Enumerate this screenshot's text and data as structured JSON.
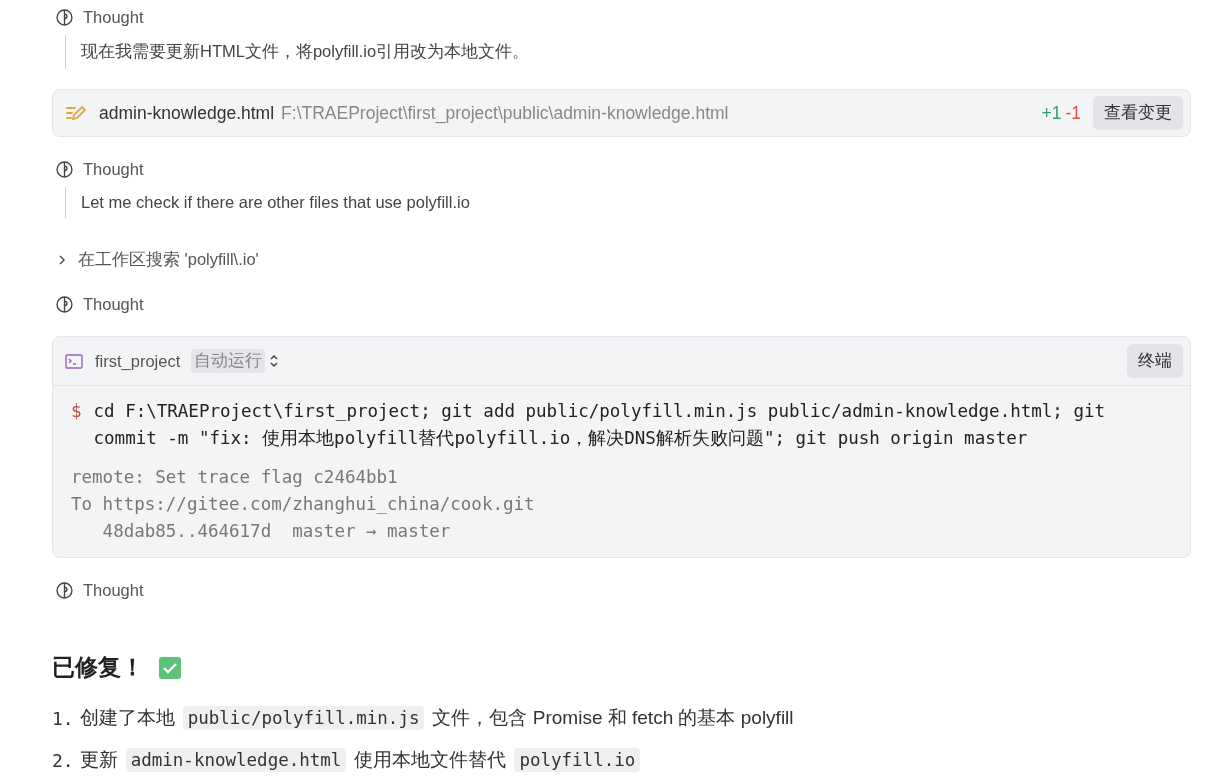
{
  "blocks": [
    {
      "kind": "thought",
      "label": "Thought",
      "text": "现在我需要更新HTML文件，将polyfill.io引用改为本地文件。"
    },
    {
      "kind": "file_edit",
      "name": "admin-knowledge.html",
      "path": "F:\\TRAEProject\\first_project\\public\\admin-knowledge.html",
      "added": "+1",
      "removed": "-1",
      "button": "查看变更"
    },
    {
      "kind": "thought",
      "label": "Thought",
      "text": "Let me check if there are other files that use polyfill.io"
    },
    {
      "kind": "search",
      "text": "在工作区搜索 'polyfill\\.io'",
      "expanded": false
    },
    {
      "kind": "thought",
      "label": "Thought"
    },
    {
      "kind": "terminal",
      "project": "first_project",
      "mode": "自动运行",
      "button": "终端",
      "prompt": "$",
      "command": "cd F:\\TRAEProject\\first_project; git add public/polyfill.min.js public/admin-knowledge.html; git commit -m \"fix: 使用本地polyfill替代polyfill.io，解决DNS解析失败问题\"; git push origin master",
      "output": [
        "remote: Set trace flag c2464bb1",
        "To https://gitee.com/zhanghui_china/cook.git",
        "   48dab85..464617d  master → master"
      ]
    },
    {
      "kind": "thought",
      "label": "Thought"
    },
    {
      "kind": "heading",
      "text": "已修复！"
    },
    {
      "kind": "list",
      "items": [
        {
          "number": "1.",
          "parts": [
            {
              "kind": "text",
              "text": "创建了本地"
            },
            {
              "kind": "code",
              "text": "public/polyfill.min.js"
            },
            {
              "kind": "text",
              "text": "文件，包含 Promise 和 fetch 的基本 polyfill"
            }
          ]
        },
        {
          "number": "2.",
          "parts": [
            {
              "kind": "text",
              "text": "更新"
            },
            {
              "kind": "code",
              "text": "admin-knowledge.html"
            },
            {
              "kind": "text",
              "text": "使用本地文件替代"
            },
            {
              "kind": "code",
              "text": "polyfill.io"
            }
          ]
        }
      ]
    }
  ]
}
